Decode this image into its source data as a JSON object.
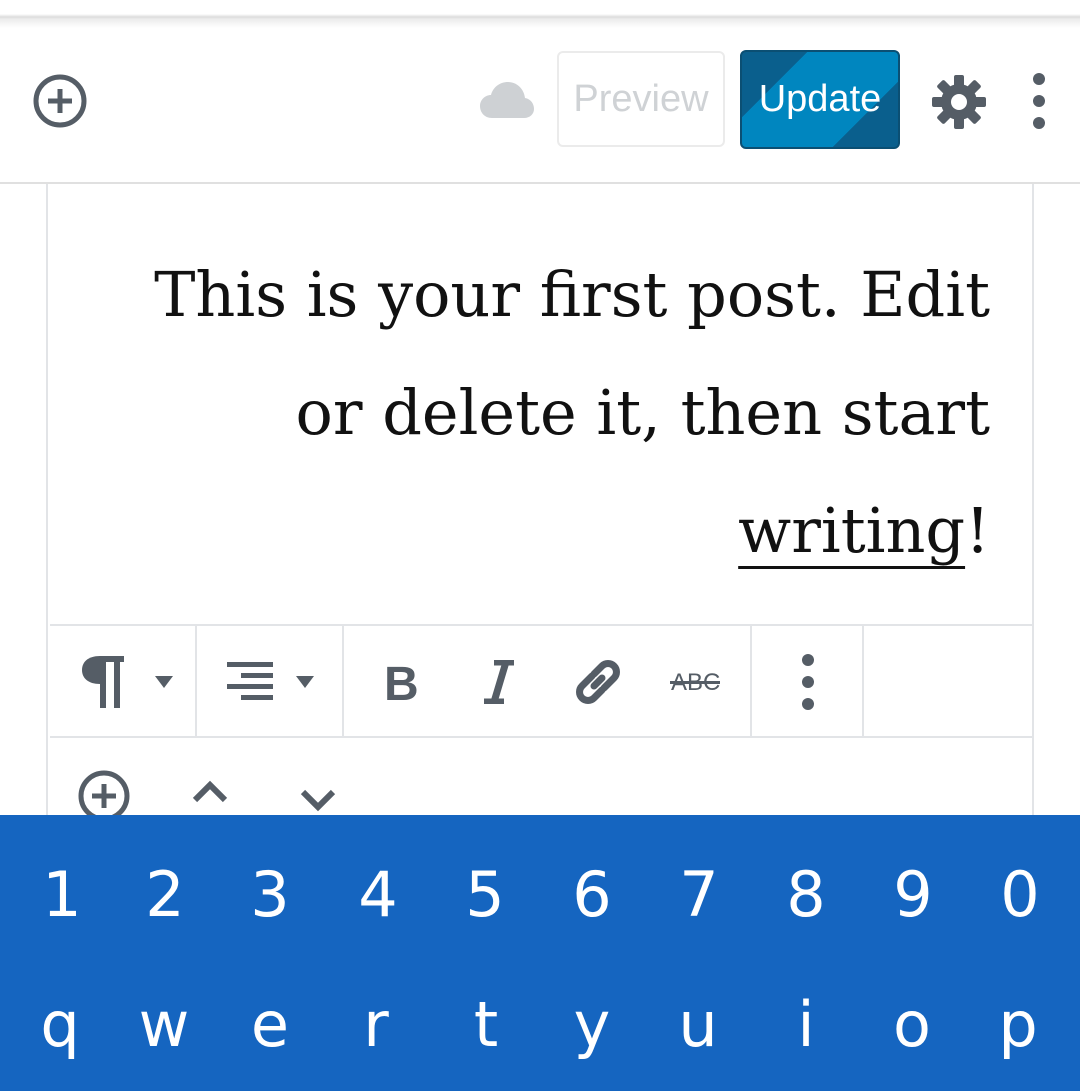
{
  "header": {
    "preview_label": "Preview",
    "update_label": "Update",
    "accent_color": "#0086bf",
    "icons": [
      "add-block-icon",
      "cloud-icon",
      "settings-gear-icon",
      "more-vertical-icon"
    ]
  },
  "editor": {
    "paragraph_text": "This is your first post. Edit or delete it, then start ",
    "link_text": "writing",
    "paragraph_end": "!",
    "alignment": "right"
  },
  "block_toolbar": {
    "items": [
      "paragraph-icon",
      "dropdown-arrow-icon",
      "align-right-icon",
      "dropdown-arrow-icon",
      "bold-icon",
      "italic-icon",
      "link-icon",
      "strikethrough-icon",
      "more-vertical-icon"
    ],
    "strikethrough_glyph": "ABC"
  },
  "bottom_toolbar": {
    "items": [
      "add-block-icon",
      "move-up-icon",
      "move-down-icon"
    ]
  },
  "keyboard": {
    "color": "#1565c0",
    "row_numbers": [
      "1",
      "2",
      "3",
      "4",
      "5",
      "6",
      "7",
      "8",
      "9",
      "0"
    ],
    "row_letters": [
      "q",
      "w",
      "e",
      "r",
      "t",
      "y",
      "u",
      "i",
      "o",
      "p"
    ]
  }
}
